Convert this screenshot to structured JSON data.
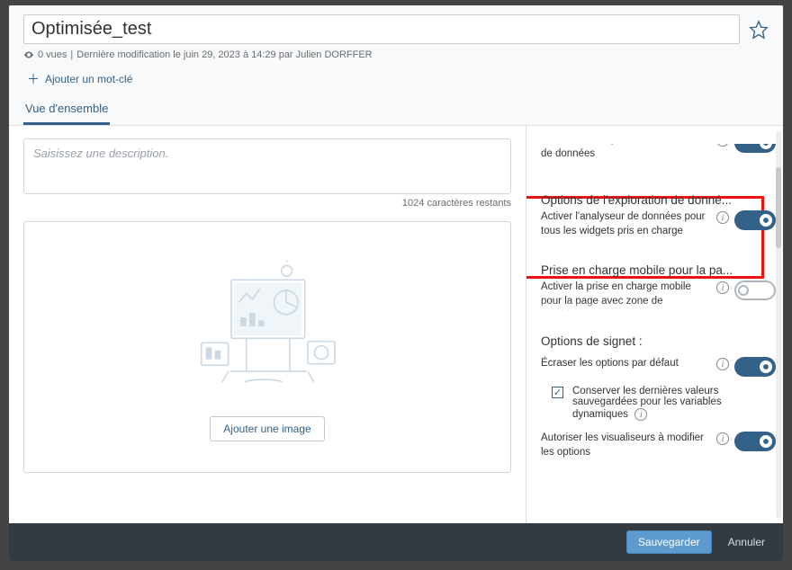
{
  "header": {
    "title": "Optimisée_test",
    "views_prefix": "0 vues",
    "last_modified": "Dernière modification le juin 29, 2023 à 14:29 par Julien DORFFER",
    "add_keyword": "Ajouter un mot-clé",
    "tab_overview": "Vue d'ensemble"
  },
  "left": {
    "desc_placeholder": "Saisissez une description.",
    "char_count": "1024 caractères restants",
    "add_image": "Ajouter une image"
  },
  "right": {
    "section1_cut_title": "",
    "section1_label": "Activer les analyses de modifications de données",
    "section2_title": "Options de l'exploration de donné...",
    "section2_label": "Activer l'analyseur de données pour tous les widgets pris en charge",
    "section3_title": "Prise en charge mobile pour la pa...",
    "section3_label": "Activer la prise en charge mobile pour la page avec zone de graphiques",
    "section4_title": "Options de signet :",
    "section4_label1": "Écraser les options par défaut",
    "section4_check": "Conserver les dernières valeurs sauvegardées pour les variables dynamiques",
    "section4_label2": "Autoriser les visualiseurs à modifier les options"
  },
  "footer": {
    "save": "Sauvegarder",
    "cancel": "Annuler"
  }
}
